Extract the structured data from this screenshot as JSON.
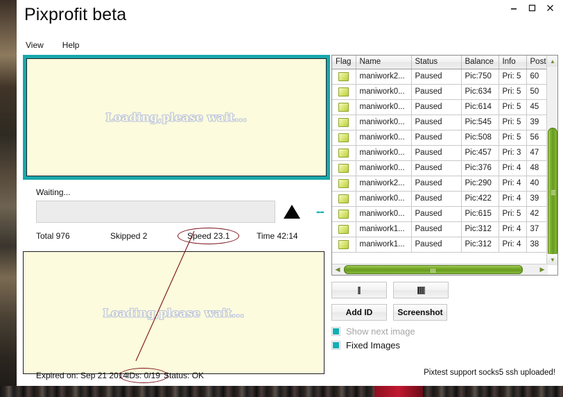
{
  "window": {
    "title": "Pixprofit beta",
    "controls": [
      {
        "name": "minimize",
        "glyph": "—"
      },
      {
        "name": "maximize",
        "glyph": "□"
      },
      {
        "name": "close",
        "glyph": "✕"
      }
    ]
  },
  "menubar": {
    "items": [
      {
        "label": "View"
      },
      {
        "label": "Help"
      }
    ]
  },
  "preview_top": {
    "text": "Loading,please wait...",
    "frame_color": "#18a8ac",
    "canvas_color": "#fcfbdd"
  },
  "preview_bottom": {
    "text": "Loading,please wait...",
    "canvas_color": "#fcfbdd"
  },
  "progress": {
    "status_label": "Waiting...",
    "percent": 0
  },
  "counters": {
    "total": "Total 976",
    "skipped": "Skipped 2",
    "speed": "Speed 23.1",
    "time": "Time 42:14"
  },
  "bottom_status": {
    "expired": "Expired on: Sep 21 2014",
    "ids": "IDs: 0/19",
    "status": "Status: OK"
  },
  "footer": {
    "note": "Pixtest support socks5  ssh uploaded!"
  },
  "grid": {
    "columns": [
      "Flag",
      "Name",
      "Status",
      "Balance",
      "Info",
      "Poste"
    ],
    "rows": [
      {
        "flag": "flag-chip-icon",
        "name": "maniwork2...",
        "status": "Paused",
        "balance": "Pic:750",
        "info": "Pri: 5",
        "posted": "60"
      },
      {
        "flag": "flag-chip-icon",
        "name": "maniwork0...",
        "status": "Paused",
        "balance": "Pic:634",
        "info": "Pri: 5",
        "posted": "50"
      },
      {
        "flag": "flag-chip-icon",
        "name": "maniwork0...",
        "status": "Paused",
        "balance": "Pic:614",
        "info": "Pri: 5",
        "posted": "45"
      },
      {
        "flag": "flag-chip-icon",
        "name": "maniwork0...",
        "status": "Paused",
        "balance": "Pic:545",
        "info": "Pri: 5",
        "posted": "39"
      },
      {
        "flag": "flag-chip-icon",
        "name": "maniwork0...",
        "status": "Paused",
        "balance": "Pic:508",
        "info": "Pri: 5",
        "posted": "56"
      },
      {
        "flag": "flag-chip-icon",
        "name": "maniwork0...",
        "status": "Paused",
        "balance": "Pic:457",
        "info": "Pri: 3",
        "posted": "47"
      },
      {
        "flag": "flag-chip-icon",
        "name": "maniwork0...",
        "status": "Paused",
        "balance": "Pic:376",
        "info": "Pri: 4",
        "posted": "48"
      },
      {
        "flag": "flag-chip-icon",
        "name": "maniwork2...",
        "status": "Paused",
        "balance": "Pic:290",
        "info": "Pri: 4",
        "posted": "40"
      },
      {
        "flag": "flag-chip-icon",
        "name": "maniwork0...",
        "status": "Paused",
        "balance": "Pic:422",
        "info": "Pri: 4",
        "posted": "39"
      },
      {
        "flag": "flag-chip-icon",
        "name": "maniwork0...",
        "status": "Paused",
        "balance": "Pic:615",
        "info": "Pri: 5",
        "posted": "42"
      },
      {
        "flag": "flag-chip-icon",
        "name": "maniwork1...",
        "status": "Paused",
        "balance": "Pic:312",
        "info": "Pri: 4",
        "posted": "37"
      },
      {
        "flag": "flag-chip-icon",
        "name": "maniwork1...",
        "status": "Paused",
        "balance": "Pic:312",
        "info": "Pri: 4",
        "posted": "38"
      }
    ]
  },
  "buttons": {
    "pause": "",
    "stop": "",
    "add_id": "Add ID",
    "screenshot": "Screenshot"
  },
  "checkboxes": [
    {
      "label": "Show next image",
      "checked": true,
      "disabled": true
    },
    {
      "label": "Fixed Images",
      "checked": true,
      "disabled": false
    }
  ],
  "colors": {
    "accent_teal": "#18a8ac",
    "canvas_cream": "#fcfbdd",
    "scroll_green": "#7fb02f",
    "annotation_red": "#7a1018"
  }
}
